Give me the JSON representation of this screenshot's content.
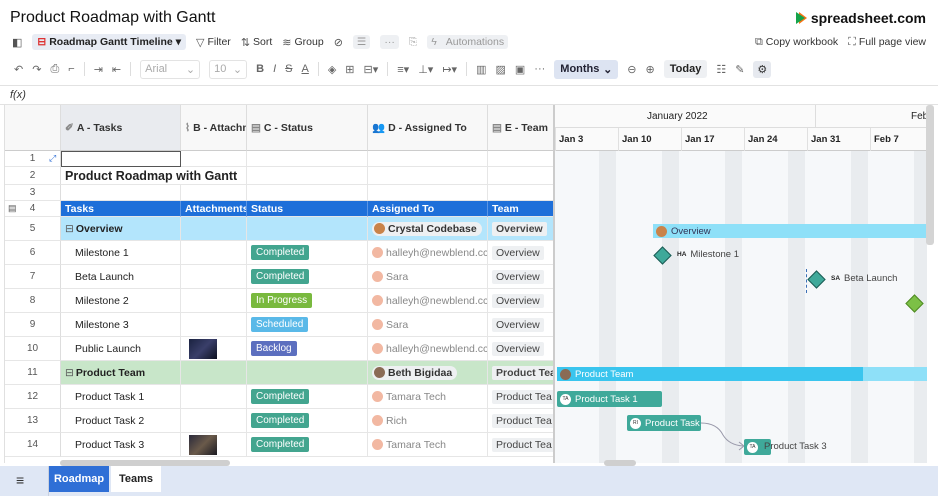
{
  "title": "Product Roadmap with Gantt",
  "brand": "spreadsheet.com",
  "menubar": {
    "sheet_view": "Roadmap Gantt Timeline",
    "filter": "Filter",
    "sort": "Sort",
    "group": "Group",
    "automations": "Automations",
    "copy_workbook": "Copy workbook",
    "full_page_view": "Full page view"
  },
  "toolbar": {
    "font": "Arial",
    "font_size": "10",
    "timescale": "Months",
    "today": "Today"
  },
  "formula_label": "f(x)",
  "columns": [
    {
      "label": "A - Tasks"
    },
    {
      "label": "B - Attachn"
    },
    {
      "label": "C - Status"
    },
    {
      "label": "D - Assigned To"
    },
    {
      "label": "E - Team"
    }
  ],
  "row_numbers": [
    "1",
    "2",
    "3",
    "4",
    "5",
    "6",
    "7",
    "8",
    "9",
    "10",
    "11",
    "12",
    "13",
    "14"
  ],
  "sheet_title_cell": "Product Roadmap with Gantt",
  "table_headers": [
    "Tasks",
    "Attachments",
    "Status",
    "Assigned To",
    "Team"
  ],
  "rows": [
    {
      "task": "Overview",
      "status": "",
      "assignee": "Crystal Codebase",
      "team": "Overview",
      "group": true,
      "group_color": "#b3e5fc"
    },
    {
      "task": "Milestone 1",
      "status": "Completed",
      "status_color": "#43a58f",
      "assignee": "halleyh@newblend.cc",
      "team": "Overview"
    },
    {
      "task": "Beta Launch",
      "status": "Completed",
      "status_color": "#43a58f",
      "assignee": "Sara",
      "team": "Overview"
    },
    {
      "task": "Milestone 2",
      "status": "In Progress",
      "status_color": "#79b93e",
      "assignee": "halleyh@newblend.cc",
      "team": "Overview"
    },
    {
      "task": "Milestone 3",
      "status": "Scheduled",
      "status_color": "#5ab9e8",
      "assignee": "Sara",
      "team": "Overview"
    },
    {
      "task": "Public Launch",
      "status": "Backlog",
      "status_color": "#5c6fbf",
      "assignee": "halleyh@newblend.cc",
      "team": "Overview",
      "attachment": true
    },
    {
      "task": "Product Team",
      "status": "",
      "assignee": "Beth Bigidaa",
      "team": "Product Tea",
      "group": true,
      "group_color": "#c8e6c9"
    },
    {
      "task": "Product Task 1",
      "status": "Completed",
      "status_color": "#43a58f",
      "assignee": "Tamara Tech",
      "team": "Product Tea"
    },
    {
      "task": "Product Task 2",
      "status": "Completed",
      "status_color": "#43a58f",
      "assignee": "Rich",
      "team": "Product Tea"
    },
    {
      "task": "Product Task 3",
      "status": "Completed",
      "status_color": "#43a58f",
      "assignee": "Tamara Tech",
      "team": "Product Tea",
      "attachment": true
    }
  ],
  "gantt": {
    "month_label": "January 2022",
    "next_month_label": "Feb",
    "weeks": [
      "Jan 3",
      "Jan 10",
      "Jan 17",
      "Jan 24",
      "Jan 31",
      "Feb 7"
    ],
    "bars": {
      "overview": "Overview",
      "milestone1": "Milestone 1",
      "milestone1_initials": "HA",
      "beta": "Beta Launch",
      "beta_initials": "SA",
      "product_team": "Product Team",
      "task1": "Product Task 1",
      "task1_initials": "TA",
      "task2": "Product Task",
      "task2_initials": "RI",
      "task3": "Product Task 3",
      "task3_initials": "TA"
    },
    "colors": {
      "group_bar": "#7dd9f7",
      "product_bar": "#3ac5ee",
      "task_bar": "#3fa99a",
      "milestone": "#3fa99a",
      "milestone_progress": "#7cc046"
    }
  },
  "tabs": [
    "Roadmap",
    "Teams"
  ],
  "active_tab": "Roadmap"
}
